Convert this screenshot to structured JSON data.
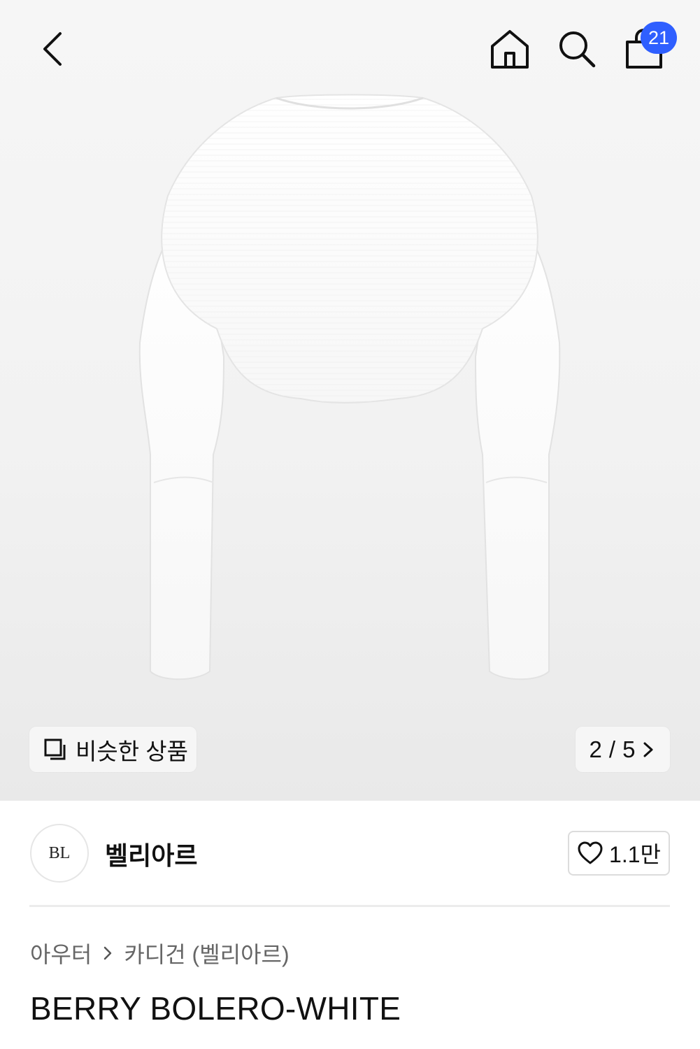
{
  "header": {
    "icons": [
      "back-icon",
      "home-icon",
      "search-icon",
      "cart-icon"
    ],
    "cart_count": "21",
    "badge_color": "#2f5fff"
  },
  "gallery": {
    "similar_label": "비슷한 상품",
    "current_page": "2",
    "separator": "/",
    "total_pages": "5"
  },
  "brand": {
    "name": "벨리아르",
    "logo_text": "BL",
    "likes": "1.1만"
  },
  "breadcrumb": {
    "items": [
      "아우터",
      "카디건 (벨리아르)"
    ]
  },
  "product": {
    "title": "BERRY BOLERO-WHITE"
  }
}
